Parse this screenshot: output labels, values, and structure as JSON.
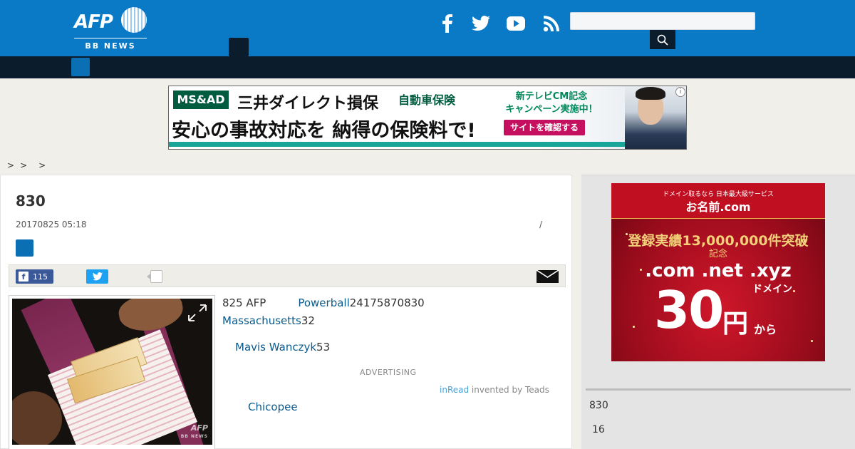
{
  "header": {
    "logo_text": "AFP",
    "logo_sub": "BB NEWS",
    "search": {
      "value": "",
      "placeholder": ""
    }
  },
  "icons": {
    "facebook": "facebook-icon",
    "twitter": "twitter-icon",
    "youtube": "youtube-icon",
    "rss": "rss-icon",
    "search": "search-icon",
    "mail": "mail-icon",
    "expand": "expand-icon"
  },
  "colors": {
    "header_blue": "#0a7ac7",
    "nav_dark": "#0b1c2c",
    "link": "#0a5a8c",
    "facebook": "#3b5998",
    "twitter": "#1da1f2"
  },
  "top_ad": {
    "brand": "MS&AD",
    "line1": "三井ダイレクト損保",
    "car": "自動車保険",
    "cm1": "新テレビCM記念",
    "cm2": "キャンペーン実施中！",
    "line2": "安心の事故対応を 納得の保険料で!",
    "cta": "サイトを確認する",
    "info": "i"
  },
  "breadcrumb": [
    ">",
    ">",
    ">"
  ],
  "article": {
    "title": "830",
    "date": "20170825 05:18",
    "slash": "/",
    "share": {
      "facebook_count": "115"
    },
    "paragraphs": {
      "p1_pre": "825 AFP",
      "p1_link": "Powerball",
      "p1_post": "24175870830",
      "p2_link": "Massachusetts",
      "p2_post": "32",
      "p3_link": "Mavis Wanczyk",
      "p3_post": "53",
      "p4_link": "Chicopee"
    },
    "advertising": "ADVERTISING",
    "inread_link": "inRead",
    "inread_text": " invented by Teads",
    "photo_watermark": "AFP",
    "photo_watermark_sub": "BB NEWS"
  },
  "sidebar": {
    "ad": {
      "small": "ドメイン取るなら 日本最大級サービス",
      "logo": "お名前.com",
      "registered": "登録実績13,000,000件突破",
      "kinen": "記念",
      "tlds": ".com .net .xyz",
      "domain": "ドメイン",
      "price": "30",
      "en": "円",
      "kara": "から"
    },
    "items": [
      "830",
      "16"
    ]
  }
}
